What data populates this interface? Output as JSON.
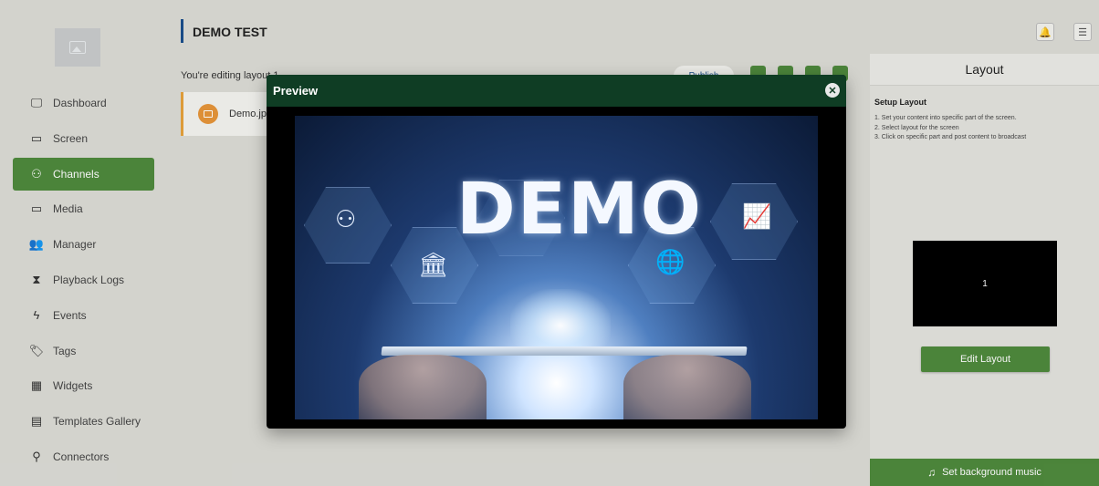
{
  "sidebar": {
    "items": [
      {
        "label": "Dashboard",
        "icon": "monitor-icon",
        "glyph": "🖵",
        "active": false
      },
      {
        "label": "Screen",
        "icon": "display-icon",
        "glyph": "▭",
        "active": false
      },
      {
        "label": "Channels",
        "icon": "network-icon",
        "glyph": "⚇",
        "active": true
      },
      {
        "label": "Media",
        "icon": "folder-icon",
        "glyph": "▭",
        "active": false
      },
      {
        "label": "Manager",
        "icon": "users-icon",
        "glyph": "👥",
        "active": false
      },
      {
        "label": "Playback Logs",
        "icon": "hourglass-icon",
        "glyph": "⧗",
        "active": false
      },
      {
        "label": "Events",
        "icon": "lightning-icon",
        "glyph": "ϟ",
        "active": false
      },
      {
        "label": "Tags",
        "icon": "tag-icon",
        "glyph": "🏷",
        "active": false
      },
      {
        "label": "Widgets",
        "icon": "widgets-icon",
        "glyph": "▦",
        "active": false
      },
      {
        "label": "Templates Gallery",
        "icon": "templates-icon",
        "glyph": "▤",
        "active": false
      },
      {
        "label": "Connectors",
        "icon": "plug-icon",
        "glyph": "⚲",
        "active": false
      }
    ]
  },
  "header": {
    "title": "DEMO TEST",
    "bell_glyph": "🔔",
    "menu_glyph": "☰"
  },
  "main": {
    "editing_text": "You're editing layout 1",
    "publish_label": "Publish",
    "media_item_name": "Demo.jpg"
  },
  "layout_panel": {
    "title": "Layout",
    "subtitle": "Setup Layout",
    "steps": [
      "1. Set your content into specific part of the screen.",
      "2. Select layout for the screen",
      "3. Click on specific part and post content to broadcast"
    ],
    "layout_zone_label": "1",
    "edit_button": "Edit Layout",
    "music_button": "Set background music",
    "music_glyph": "♫"
  },
  "preview_modal": {
    "title": "Preview",
    "close_glyph": "✕",
    "image_text": "DEMO"
  },
  "colors": {
    "accent_green": "#4f8a3d",
    "modal_header": "#0f3d24",
    "title_bar": "#1b4f8c",
    "media_accent": "#e6a23c"
  }
}
